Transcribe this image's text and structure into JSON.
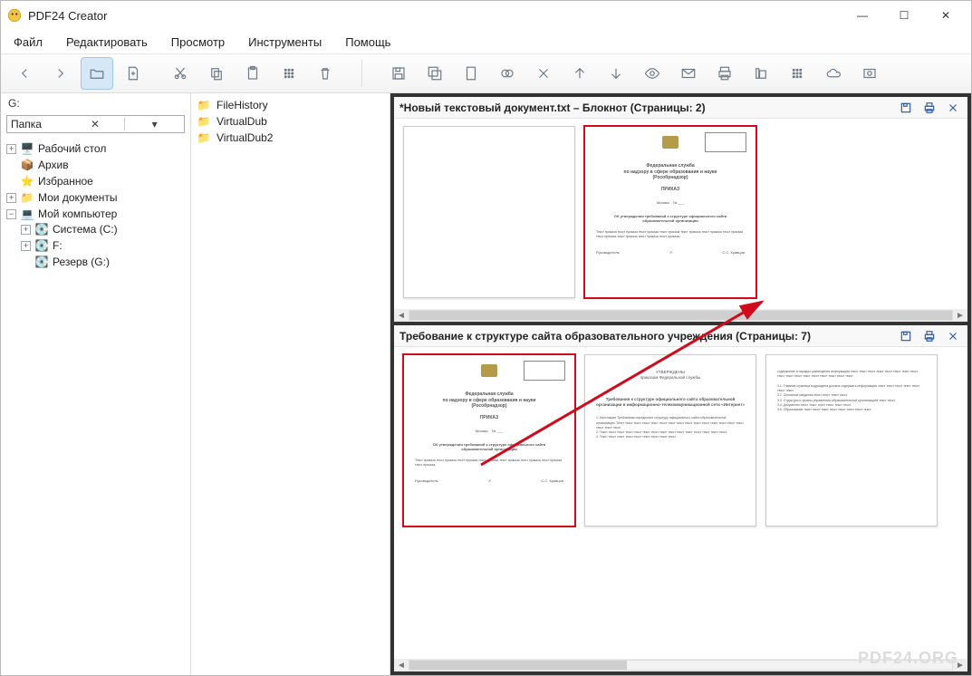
{
  "app": {
    "title": "PDF24 Creator"
  },
  "menu": {
    "file": "Файл",
    "edit": "Редактировать",
    "view": "Просмотр",
    "tools": "Инструменты",
    "help": "Помощь"
  },
  "winctrl": {
    "min": "—",
    "max": "☐",
    "close": "✕"
  },
  "nav": {
    "drive_label": "G:",
    "combo_label": "Папка",
    "tree": {
      "desktop": "Рабочий стол",
      "archive": "Архив",
      "favorites": "Избранное",
      "mydocs": "Мои документы",
      "mycomputer": "Мой компьютер",
      "drive_c": "Система (C:)",
      "drive_f": "F:",
      "drive_g": "Резерв (G:)"
    }
  },
  "folder_list": {
    "f1": "FileHistory",
    "f2": "VirtualDub",
    "f3": "VirtualDub2"
  },
  "doc1": {
    "title": "*Новый текстовый документ.txt – Блокнот (Страницы: 2)"
  },
  "doc2": {
    "title": "Требование к структуре сайта образовательного учреждения (Страницы: 7)"
  },
  "brand": "PDF24.ORG"
}
